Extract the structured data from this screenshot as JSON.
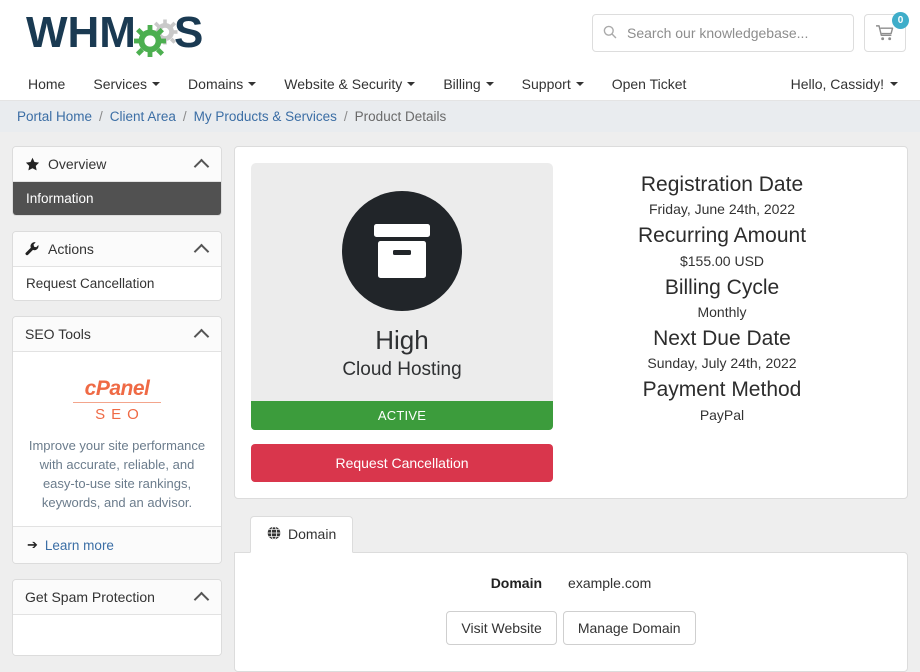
{
  "header": {
    "logo_text": "WHMCS",
    "search": {
      "placeholder": "Search our knowledgebase...",
      "value": ""
    },
    "cart": {
      "count": "0",
      "icon": "shopping-cart-icon"
    }
  },
  "nav": {
    "items": [
      {
        "label": "Home",
        "caret": false
      },
      {
        "label": "Services",
        "caret": true
      },
      {
        "label": "Domains",
        "caret": true
      },
      {
        "label": "Website & Security",
        "caret": true
      },
      {
        "label": "Billing",
        "caret": true
      },
      {
        "label": "Support",
        "caret": true
      },
      {
        "label": "Open Ticket",
        "caret": false
      }
    ],
    "user_label": "Hello, Cassidy!"
  },
  "breadcrumb": {
    "items": [
      "Portal Home",
      "Client Area",
      "My Products & Services"
    ],
    "current": "Product Details",
    "separator": "/"
  },
  "sidebar": {
    "overview": {
      "title": "Overview",
      "icon": "star-icon",
      "items": [
        {
          "label": "Information",
          "active": true
        }
      ]
    },
    "actions": {
      "title": "Actions",
      "icon": "wrench-icon",
      "items": [
        {
          "label": "Request Cancellation",
          "active": false
        }
      ]
    },
    "seo_tools": {
      "title": "SEO Tools",
      "logo_word": "cPanel",
      "logo_seo": "SEO",
      "description": "Improve your site performance with accurate, reliable, and easy-to-use site rankings, keywords, and an advisor.",
      "learn_more": "Learn more",
      "arrow": "➔"
    },
    "spam_protection": {
      "title": "Get Spam Protection"
    }
  },
  "product": {
    "name": "High",
    "group": "Cloud Hosting",
    "icon": "archive-box-icon",
    "status": "ACTIVE",
    "cancel_label": "Request Cancellation",
    "details": [
      {
        "label": "Registration Date",
        "value": "Friday, June 24th, 2022"
      },
      {
        "label": "Recurring Amount",
        "value": "$155.00 USD"
      },
      {
        "label": "Billing Cycle",
        "value": "Monthly"
      },
      {
        "label": "Next Due Date",
        "value": "Sunday, July 24th, 2022"
      },
      {
        "label": "Payment Method",
        "value": "PayPal"
      }
    ]
  },
  "tabs": {
    "items": [
      {
        "label": "Domain",
        "icon": "globe-icon",
        "active": true
      }
    ],
    "domain_panel": {
      "key": "Domain",
      "value": "example.com",
      "buttons": [
        "Visit Website",
        "Manage Domain"
      ]
    }
  },
  "colors": {
    "status_active": "#3c9c3c",
    "danger": "#d9364c",
    "accent_link": "#3b6ea5",
    "cart_badge": "#3fadc9",
    "cpanel_orange": "#ef6a45",
    "logo_navy": "#1a3a52",
    "logo_green": "#4caf50"
  }
}
